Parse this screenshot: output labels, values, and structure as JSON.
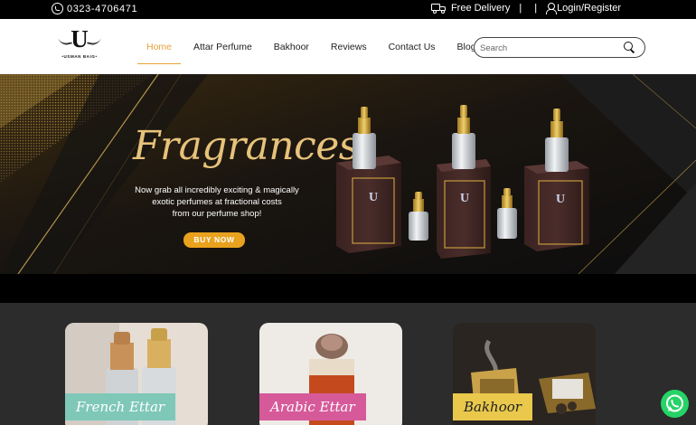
{
  "topbar": {
    "phone": "0323-4706471",
    "delivery": "Free Delivery",
    "divider": "|",
    "login": "Login/Register"
  },
  "logo": {
    "mark": "U",
    "brand": "•USMAN BAIG•"
  },
  "nav": [
    {
      "label": "Home",
      "active": true
    },
    {
      "label": "Attar Perfume",
      "active": false
    },
    {
      "label": "Bakhoor",
      "active": false
    },
    {
      "label": "Reviews",
      "active": false
    },
    {
      "label": "Contact Us",
      "active": false
    },
    {
      "label": "Blogs",
      "active": false
    }
  ],
  "search": {
    "placeholder": "Search"
  },
  "hero": {
    "title": "Fragrances",
    "text_lines": [
      "Now grab all incredibly exciting & magically",
      "exotic perfumes at fractional costs",
      "from our perfume shop!"
    ],
    "button": "BUY NOW",
    "box_mark": "U"
  },
  "categories": [
    {
      "label": "French Ettar",
      "label_color": "#7fc8b8"
    },
    {
      "label": "Arabic Ettar",
      "label_color": "#d65a9a"
    },
    {
      "label": "Bakhoor",
      "label_color": "#e9c84c"
    }
  ],
  "colors": {
    "accent": "#e5a33a",
    "button": "#e8a21e",
    "title_gold": "#e7c27a",
    "whatsapp": "#25d366"
  },
  "icons": [
    "whatsapp-icon",
    "truck-icon",
    "user-icon",
    "search-icon",
    "whatsapp-float-icon"
  ]
}
